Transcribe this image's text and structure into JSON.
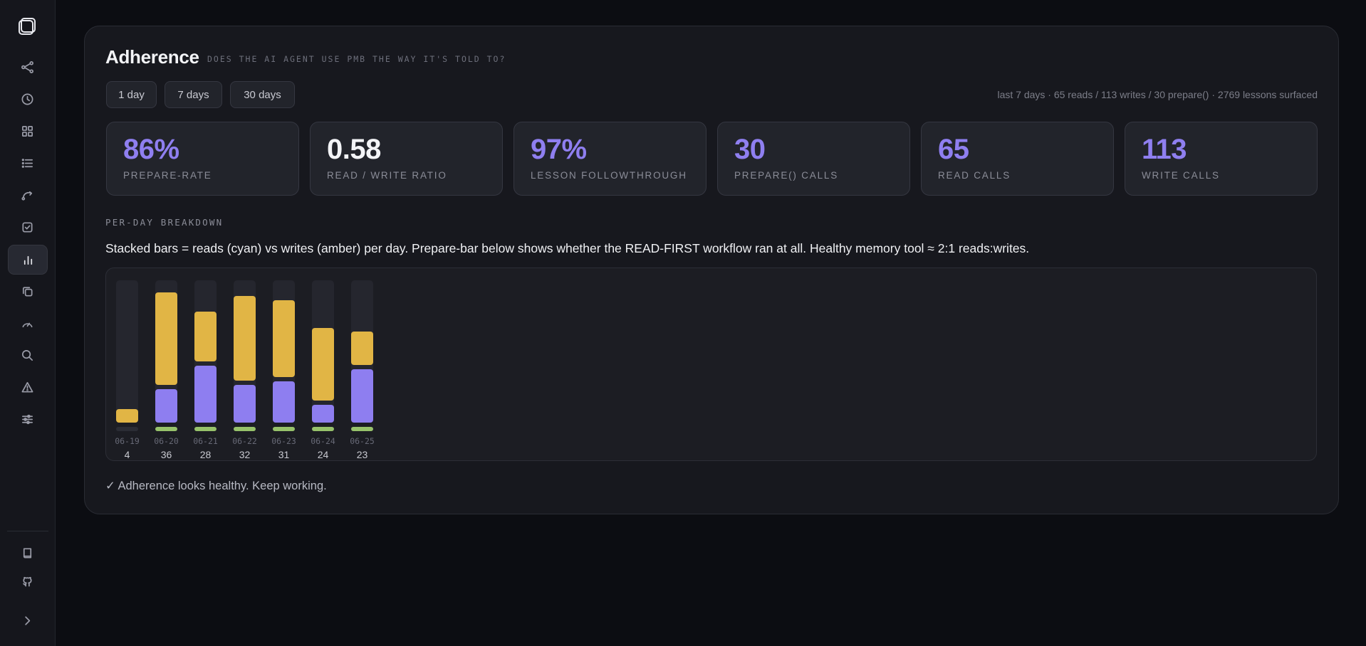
{
  "page": {
    "title": "Adherence",
    "subtitle": "DOES THE AI AGENT USE PMB THE WAY IT'S TOLD TO?",
    "summary": "last 7 days · 65 reads / 113 writes / 30 prepare() · 2769 lessons surfaced"
  },
  "sidebar": {
    "icons": [
      "logo-icon",
      "graph-icon",
      "clock-icon",
      "grid-icon",
      "list-icon",
      "curve-icon",
      "checkbox-icon",
      "bar-chart-icon",
      "copy-icon",
      "gauge-icon",
      "search-icon",
      "warning-icon",
      "sliders-icon",
      "book-icon",
      "github-icon",
      "chevron-right-icon"
    ],
    "active": "bar-chart-icon"
  },
  "ranges": [
    {
      "label": "1 day"
    },
    {
      "label": "7 days"
    },
    {
      "label": "30 days"
    }
  ],
  "stats": [
    {
      "value": "86%",
      "label": "PREPARE-RATE"
    },
    {
      "value": "0.58",
      "label": "READ / WRITE RATIO"
    },
    {
      "value": "97%",
      "label": "LESSON FOLLOWTHROUGH"
    },
    {
      "value": "30",
      "label": "PREPARE() CALLS"
    },
    {
      "value": "65",
      "label": "READ CALLS"
    },
    {
      "value": "113",
      "label": "WRITE CALLS"
    }
  ],
  "breakdown": {
    "heading": "PER-DAY BREAKDOWN",
    "description": "Stacked bars = reads (cyan) vs writes (amber) per day. Prepare-bar below shows whether the READ-FIRST workflow ran at all. Healthy memory tool ≈ 2:1 reads:writes."
  },
  "chart_data": {
    "type": "bar",
    "stacked": true,
    "categories": [
      "06-19",
      "06-20",
      "06-21",
      "06-22",
      "06-23",
      "06-24",
      "06-25"
    ],
    "totals": [
      "4",
      "36",
      "28",
      "32",
      "31",
      "24",
      "23"
    ],
    "ylim": [
      0,
      36
    ],
    "series": [
      {
        "name": "reads",
        "color": "#8e7ef0",
        "values": [
          0,
          9,
          15,
          10,
          11,
          5,
          14
        ]
      },
      {
        "name": "writes",
        "color": "#e1b545",
        "values": [
          4,
          24,
          13,
          22,
          20,
          19,
          9
        ]
      }
    ],
    "prepare": [
      false,
      true,
      true,
      true,
      true,
      true,
      true
    ],
    "colors": {
      "prepare_on": "#97c26b",
      "prepare_off": "#2b2d35"
    }
  },
  "status": "✓ Adherence looks healthy. Keep working."
}
